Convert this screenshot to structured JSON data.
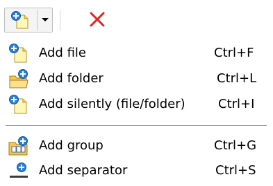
{
  "toolbar": {
    "add_button_icon": "add-file-icon",
    "dropdown_icon": "chevron-down-icon",
    "delete_icon": "red-x-icon"
  },
  "menu": {
    "items": [
      {
        "label": "Add file",
        "shortcut": "Ctrl+F",
        "icon": "add-file-icon"
      },
      {
        "label": "Add folder",
        "shortcut": "Ctrl+L",
        "icon": "add-folder-icon"
      },
      {
        "label": "Add silently (file/folder)",
        "shortcut": "Ctrl+I",
        "icon": "add-silently-icon"
      },
      {
        "label": "Add group",
        "shortcut": "Ctrl+G",
        "icon": "add-group-icon"
      },
      {
        "label": "Add separator",
        "shortcut": "Ctrl+S",
        "icon": "add-separator-icon"
      }
    ]
  },
  "colors": {
    "delete_red": "#e8211c",
    "plus_blue": "#2a7fd8",
    "folder_yellow": "#f5c94a",
    "separator_gray": "#a0a0a0"
  }
}
